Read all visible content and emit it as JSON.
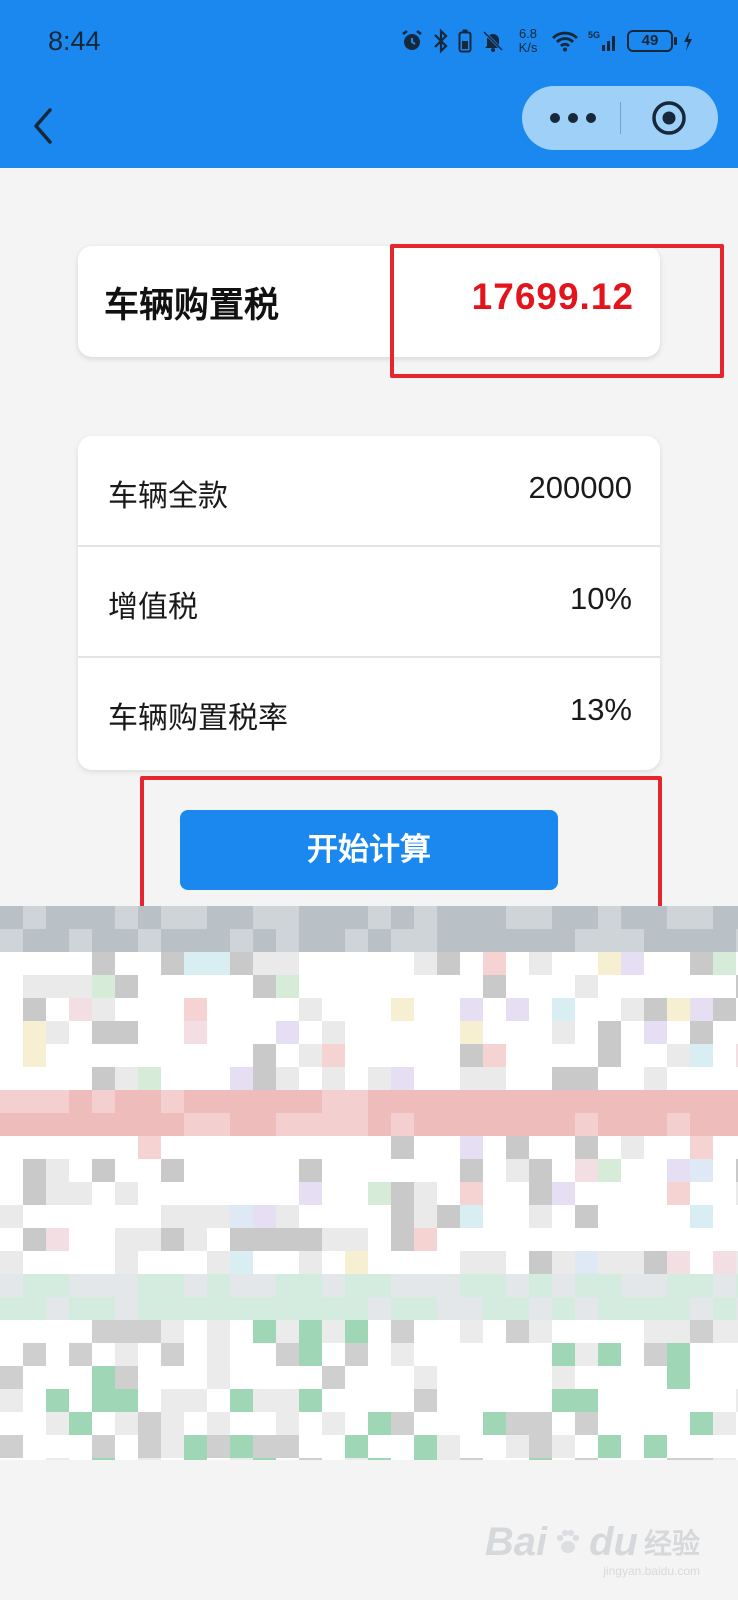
{
  "status_bar": {
    "time": "8:44",
    "network_speed_top": "6.8",
    "network_speed_bottom": "K/s",
    "battery": "49",
    "icons": [
      "alarm-icon",
      "bluetooth-icon",
      "mute-icon",
      "wifi-icon",
      "5g-signal-icon",
      "battery-icon",
      "charging-icon"
    ]
  },
  "nav": {
    "back_icon": "chevron-left-icon",
    "more_icon": "more-dots-icon",
    "close_icon": "target-circle-icon"
  },
  "result": {
    "label": "车辆购置税",
    "value": "17699.12"
  },
  "form": {
    "rows": [
      {
        "label": "车辆全款",
        "value": "200000"
      },
      {
        "label": "增值税",
        "value": "10%"
      },
      {
        "label": "车辆购置税率",
        "value": "13%"
      }
    ]
  },
  "button": {
    "label": "开始计算"
  },
  "watermark": {
    "bai": "Bai",
    "du": "du",
    "cn": "经验",
    "url": "jingyan.baidu.com"
  },
  "colors": {
    "header": "#1a88ee",
    "accent": "#1a88ee",
    "result_value": "#e3141c",
    "highlight": "#e6262e",
    "background": "#f4f4f4"
  }
}
